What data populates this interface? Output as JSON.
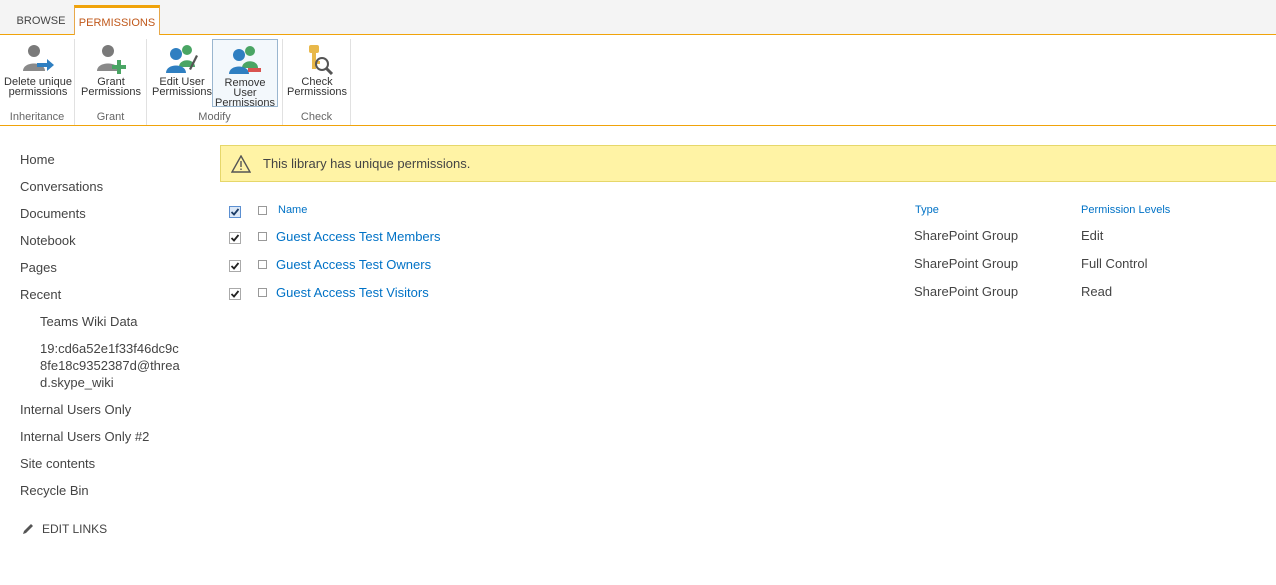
{
  "tabs": [
    {
      "label": "BROWSE"
    },
    {
      "label": "PERMISSIONS"
    }
  ],
  "ribbon": {
    "groups": [
      {
        "label": "Inheritance",
        "buttons": [
          {
            "label": "Delete unique\npermissions",
            "icon": "delete-permissions-icon"
          }
        ]
      },
      {
        "label": "Grant",
        "buttons": [
          {
            "label": "Grant\nPermissions",
            "icon": "grant-permissions-icon"
          }
        ]
      },
      {
        "label": "Modify",
        "buttons": [
          {
            "label": "Edit User\nPermissions",
            "icon": "edit-user-permissions-icon"
          },
          {
            "label": "Remove User\nPermissions",
            "icon": "remove-user-permissions-icon"
          }
        ]
      },
      {
        "label": "Check",
        "buttons": [
          {
            "label": "Check\nPermissions",
            "icon": "check-permissions-icon"
          }
        ]
      }
    ]
  },
  "nav": {
    "items": [
      {
        "label": "Home"
      },
      {
        "label": "Conversations"
      },
      {
        "label": "Documents"
      },
      {
        "label": "Notebook"
      },
      {
        "label": "Pages"
      },
      {
        "label": "Recent"
      },
      {
        "label": "Teams Wiki Data"
      },
      {
        "label": "19:cd6a52e1f33f46dc9c8fe18c9352387d@thread.skype_wiki"
      },
      {
        "label": "Internal Users Only"
      },
      {
        "label": "Internal Users Only #2"
      },
      {
        "label": "Site contents"
      },
      {
        "label": "Recycle Bin"
      }
    ],
    "edit_links": "EDIT LINKS"
  },
  "warning": {
    "text": "This library has unique permissions."
  },
  "table": {
    "headers": {
      "name": "Name",
      "type": "Type",
      "levels": "Permission Levels"
    },
    "rows": [
      {
        "name": "Guest Access Test Members",
        "type": "SharePoint Group",
        "level": "Edit",
        "checked": true
      },
      {
        "name": "Guest Access Test Owners",
        "type": "SharePoint Group",
        "level": "Full Control",
        "checked": true
      },
      {
        "name": "Guest Access Test Visitors",
        "type": "SharePoint Group",
        "level": "Read",
        "checked": true
      }
    ]
  },
  "colors": {
    "accent": "#f0a30a",
    "link": "#0072c6",
    "warning_bg": "#fff3a5",
    "tab_active_text": "#c0581a"
  }
}
